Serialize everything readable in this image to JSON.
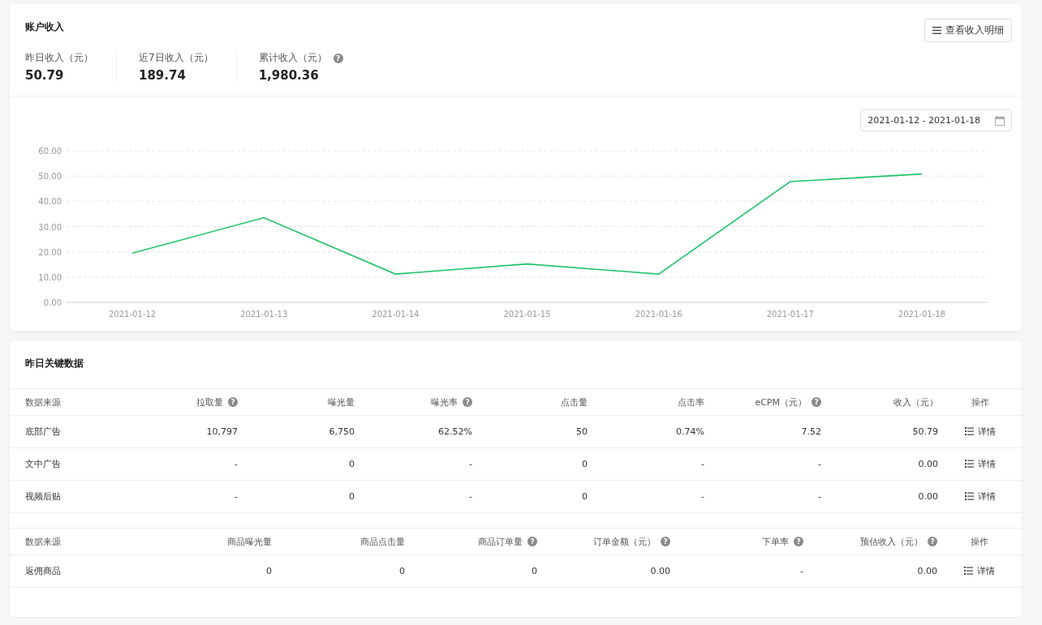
{
  "account_income": {
    "title": "账户收入",
    "detail_button": "查看收入明细",
    "stats": [
      {
        "label": "昨日收入（元）",
        "value": "50.79"
      },
      {
        "label": "近7日收入（元）",
        "value": "189.74"
      },
      {
        "label": "累计收入（元）",
        "value": "1,980.36",
        "help": "?"
      }
    ]
  },
  "date_range": "2021-01-12 - 2021-01-18",
  "chart_data": {
    "type": "line",
    "categories": [
      "2021-01-12",
      "2021-01-13",
      "2021-01-14",
      "2021-01-15",
      "2021-01-16",
      "2021-01-17",
      "2021-01-18"
    ],
    "series": [
      {
        "color": "#1fc46a",
        "values": [
          19.5,
          33.5,
          11.2,
          15.2,
          11.2,
          47.8,
          50.8
        ]
      }
    ],
    "grid": true,
    "ylim": [
      0,
      60
    ],
    "yticks": [
      {
        "value": 0,
        "label": "0.00"
      },
      {
        "value": 10,
        "label": "10.00"
      },
      {
        "value": 20,
        "label": "20.00"
      },
      {
        "value": 30,
        "label": "30.00"
      },
      {
        "value": 40,
        "label": "40.00"
      },
      {
        "value": 50,
        "label": "50.00"
      },
      {
        "value": 60,
        "label": "60.00"
      }
    ]
  },
  "key_data": {
    "title": "昨日关键数据",
    "tables": [
      {
        "columns": [
          {
            "label": "数据来源"
          },
          {
            "label": "拉取量",
            "help": "?"
          },
          {
            "label": "曝光量"
          },
          {
            "label": "曝光率",
            "help": "?"
          },
          {
            "label": "点击量"
          },
          {
            "label": "点击率"
          },
          {
            "label": "eCPM（元）",
            "help": "?"
          },
          {
            "label": "收入（元）"
          },
          {
            "label": "操作"
          }
        ],
        "rows": [
          {
            "cells": [
              "底部广告",
              "10,797",
              "6,750",
              "62.52%",
              "50",
              "0.74%",
              "7.52",
              "50.79"
            ],
            "action": "详情"
          },
          {
            "cells": [
              "文中广告",
              "-",
              "0",
              "-",
              "0",
              "-",
              "-",
              "0.00"
            ],
            "action": "详情"
          },
          {
            "cells": [
              "视频后贴",
              "-",
              "0",
              "-",
              "0",
              "-",
              "-",
              "0.00"
            ],
            "action": "详情"
          }
        ]
      },
      {
        "columns": [
          {
            "label": "数据来源"
          },
          {
            "label": "商品曝光量"
          },
          {
            "label": "商品点击量"
          },
          {
            "label": "商品订单量",
            "help": "?"
          },
          {
            "label": "订单金额（元）",
            "help": "?"
          },
          {
            "label": "下单率",
            "help": "?"
          },
          {
            "label": "预估收入（元）",
            "help": "?"
          },
          {
            "label": "操作"
          }
        ],
        "rows": [
          {
            "cells": [
              "返佣商品",
              "0",
              "0",
              "0",
              "0.00",
              "-",
              "0.00"
            ],
            "action": "详情"
          }
        ]
      }
    ]
  }
}
